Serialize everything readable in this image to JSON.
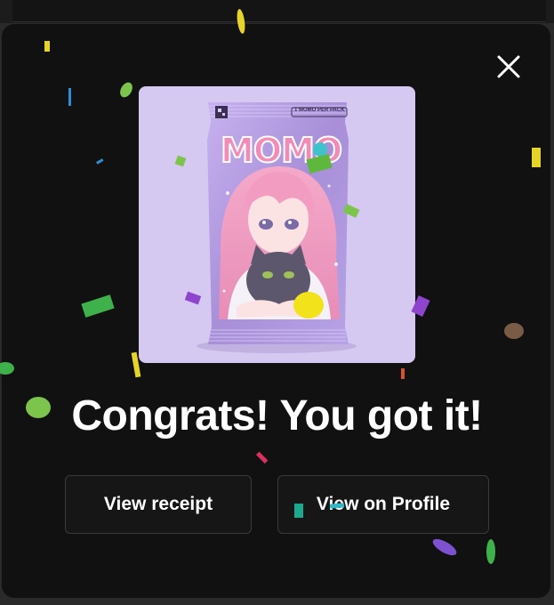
{
  "modal": {
    "headline": "Congrats! You got it!",
    "close_icon": "close-icon",
    "buttons": {
      "view_receipt": "View receipt",
      "view_on_profile": "View on Profile"
    }
  },
  "pack": {
    "brand_title": "MOMO",
    "tag": "1 MOMO PER PACK",
    "image_description_icon": "anime-girl-with-cat-illustration"
  },
  "colors": {
    "modal_bg": "#111111",
    "pack_bg": "#d5c8f1",
    "foil": "#b9a2e4",
    "title_pink": "#f48ab8",
    "button_bg": "#161616",
    "button_border": "#3a3a3a"
  }
}
